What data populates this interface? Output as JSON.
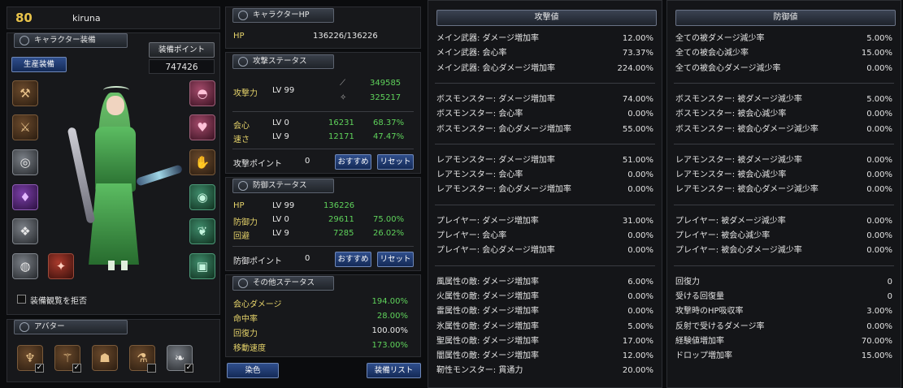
{
  "header": {
    "level": "80",
    "name": "kiruna"
  },
  "equipment": {
    "tab_label": "キャラクター装備",
    "production_button": "生産装備",
    "points_label": "装備ポイント",
    "points_value": "747426",
    "view_toggle_label": "装備観覧を拒否",
    "left_slots": [
      "weapon-icon",
      "armor-icon",
      "ring-icon",
      "gem-icon",
      "necklace-icon",
      "shield-icon"
    ],
    "right_slots": [
      "helmet-icon",
      "chest-icon",
      "gloves-icon",
      "belt-icon",
      "boots-icon",
      "accessory-icon"
    ]
  },
  "avatar": {
    "tab_label": "アバター",
    "slots": [
      {
        "icon": "avatar-hair-icon",
        "checked": true
      },
      {
        "icon": "avatar-top-icon",
        "checked": true
      },
      {
        "icon": "avatar-bottom-icon",
        "checked": false
      },
      {
        "icon": "avatar-shoes-icon",
        "checked": false
      },
      {
        "icon": "avatar-wing-icon",
        "checked": true
      }
    ]
  },
  "hp_section": {
    "tab_label": "キャラクターHP",
    "label": "HP",
    "value": "136226/136226"
  },
  "attack_section": {
    "tab_label": "攻撃ステータス",
    "attack_label": "攻撃力",
    "attack_lv": "LV 99",
    "attack_v1": "349585",
    "attack_v2": "325217",
    "crit_label": "会心",
    "crit_lv": "LV 0",
    "crit_val": "16231",
    "crit_pct": "68.37%",
    "speed_label": "速さ",
    "speed_lv": "LV 9",
    "speed_val": "12171",
    "speed_pct": "47.47%",
    "points_label": "攻撃ポイント",
    "points_value": "0",
    "recommend_button": "おすすめ",
    "reset_button": "リセット"
  },
  "defense_section": {
    "tab_label": "防御ステータス",
    "hp_label": "HP",
    "hp_lv": "LV 99",
    "hp_val": "136226",
    "def_label": "防御力",
    "def_lv": "LV 0",
    "def_val": "29611",
    "def_pct": "75.00%",
    "evade_label": "回避",
    "evade_lv": "LV 9",
    "evade_val": "7285",
    "evade_pct": "26.02%",
    "points_label": "防御ポイント",
    "points_value": "0",
    "recommend_button": "おすすめ",
    "reset_button": "リセット"
  },
  "other_section": {
    "tab_label": "その他ステータス",
    "rows": [
      {
        "label": "会心ダメージ",
        "value": "194.00%"
      },
      {
        "label": "命中率",
        "value": "28.00%"
      },
      {
        "label": "回復力",
        "value": "100.00%"
      },
      {
        "label": "移動速度",
        "value": "173.00%"
      }
    ]
  },
  "bottom_buttons": {
    "dye": "染色",
    "equip_list": "装備リスト"
  },
  "attack_values": {
    "title": "攻撃値",
    "groups": [
      [
        {
          "label": "メイン武器: ダメージ増加率",
          "value": "12.00%"
        },
        {
          "label": "メイン武器: 会心率",
          "value": "73.37%"
        },
        {
          "label": "メイン武器: 会心ダメージ増加率",
          "value": "224.00%"
        }
      ],
      [
        {
          "label": "ボスモンスター: ダメージ増加率",
          "value": "74.00%"
        },
        {
          "label": "ボスモンスター: 会心率",
          "value": "0.00%"
        },
        {
          "label": "ボスモンスター: 会心ダメージ増加率",
          "value": "55.00%"
        }
      ],
      [
        {
          "label": "レアモンスター: ダメージ増加率",
          "value": "51.00%"
        },
        {
          "label": "レアモンスター: 会心率",
          "value": "0.00%"
        },
        {
          "label": "レアモンスター: 会心ダメージ増加率",
          "value": "0.00%"
        }
      ],
      [
        {
          "label": "プレイヤー: ダメージ増加率",
          "value": "31.00%"
        },
        {
          "label": "プレイヤー: 会心率",
          "value": "0.00%"
        },
        {
          "label": "プレイヤー: 会心ダメージ増加率",
          "value": "0.00%"
        }
      ],
      [
        {
          "label": "風属性の敵: ダメージ増加率",
          "value": "6.00%"
        },
        {
          "label": "火属性の敵: ダメージ増加率",
          "value": "0.00%"
        },
        {
          "label": "雷属性の敵: ダメージ増加率",
          "value": "0.00%"
        },
        {
          "label": "氷属性の敵: ダメージ増加率",
          "value": "5.00%"
        },
        {
          "label": "聖属性の敵: ダメージ増加率",
          "value": "17.00%"
        },
        {
          "label": "闇属性の敵: ダメージ増加率",
          "value": "12.00%"
        },
        {
          "label": "靭性モンスター: 貫通力",
          "value": "20.00%"
        }
      ]
    ]
  },
  "defense_values": {
    "title": "防御値",
    "groups": [
      [
        {
          "label": "全ての被ダメージ減少率",
          "value": "5.00%"
        },
        {
          "label": "全ての被会心減少率",
          "value": "15.00%"
        },
        {
          "label": "全ての被会心ダメージ減少率",
          "value": "0.00%"
        }
      ],
      [
        {
          "label": "ボスモンスター: 被ダメージ減少率",
          "value": "5.00%"
        },
        {
          "label": "ボスモンスター: 被会心減少率",
          "value": "0.00%"
        },
        {
          "label": "ボスモンスター: 被会心ダメージ減少率",
          "value": "0.00%"
        }
      ],
      [
        {
          "label": "レアモンスター: 被ダメージ減少率",
          "value": "0.00%"
        },
        {
          "label": "レアモンスター: 被会心減少率",
          "value": "0.00%"
        },
        {
          "label": "レアモンスター: 被会心ダメージ減少率",
          "value": "0.00%"
        }
      ],
      [
        {
          "label": "プレイヤー: 被ダメージ減少率",
          "value": "0.00%"
        },
        {
          "label": "プレイヤー: 被会心減少率",
          "value": "0.00%"
        },
        {
          "label": "プレイヤー: 被会心ダメージ減少率",
          "value": "0.00%"
        }
      ],
      [
        {
          "label": "回復力",
          "value": "0"
        },
        {
          "label": "受ける回復量",
          "value": "0"
        },
        {
          "label": "攻撃時のHP吸収率",
          "value": "3.00%"
        },
        {
          "label": "反射で受けるダメージ率",
          "value": "0.00%"
        },
        {
          "label": "経験値増加率",
          "value": "70.00%"
        },
        {
          "label": "ドロップ増加率",
          "value": "15.00%"
        }
      ]
    ]
  }
}
